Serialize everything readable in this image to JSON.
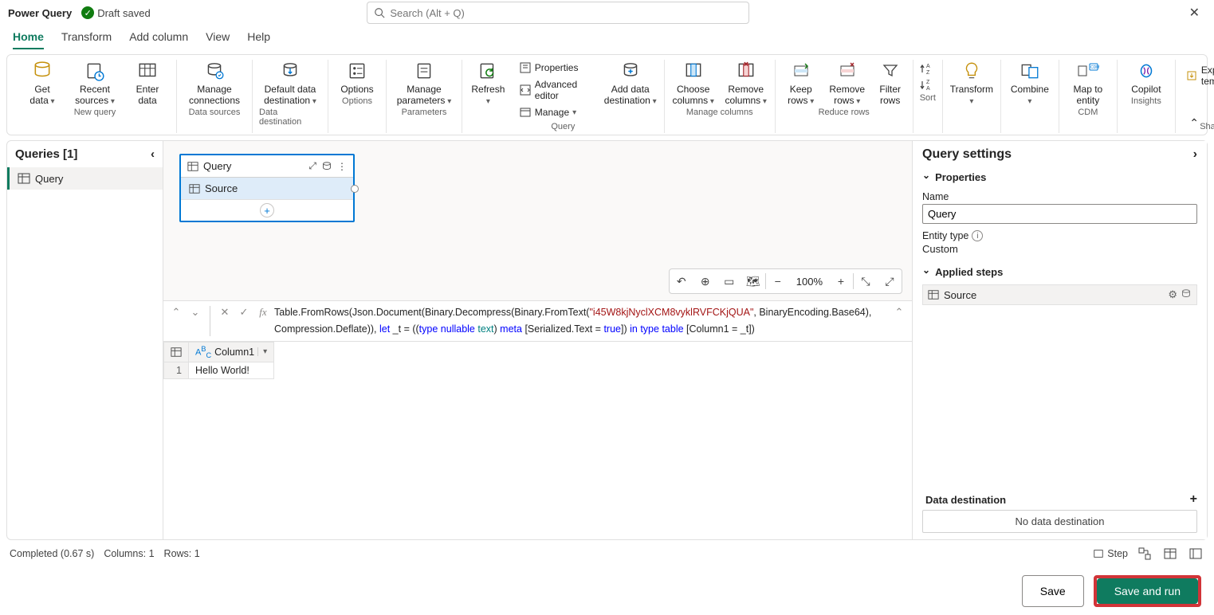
{
  "topbar": {
    "app_title": "Power Query",
    "status": "Draft saved",
    "search_placeholder": "Search (Alt + Q)"
  },
  "tabs": [
    "Home",
    "Transform",
    "Add column",
    "View",
    "Help"
  ],
  "active_tab": "Home",
  "ribbon": {
    "groups": {
      "new_query": {
        "label": "New query",
        "get_data": "Get\ndata",
        "recent_sources": "Recent\nsources",
        "enter_data": "Enter\ndata"
      },
      "data_sources": {
        "label": "Data sources",
        "manage_connections": "Manage\nconnections"
      },
      "data_destination": {
        "label": "Data destination",
        "default_dd": "Default data\ndestination"
      },
      "options": {
        "label": "Options",
        "options": "Options"
      },
      "parameters": {
        "label": "Parameters",
        "manage_params": "Manage\nparameters"
      },
      "query": {
        "label": "Query",
        "refresh": "Refresh",
        "properties": "Properties",
        "advanced_editor": "Advanced editor",
        "manage": "Manage",
        "add_dd": "Add data\ndestination"
      },
      "manage_columns": {
        "label": "Manage columns",
        "choose_cols": "Choose\ncolumns",
        "remove_cols": "Remove\ncolumns"
      },
      "reduce_rows": {
        "label": "Reduce rows",
        "keep_rows": "Keep\nrows",
        "remove_rows": "Remove\nrows",
        "filter_rows": "Filter\nrows"
      },
      "sort": {
        "label": "Sort"
      },
      "transform": {
        "label": "",
        "transform": "Transform"
      },
      "combine": {
        "label": "",
        "combine": "Combine"
      },
      "cdm": {
        "label": "CDM",
        "map_entity": "Map to\nentity"
      },
      "insights": {
        "label": "Insights",
        "copilot": "Copilot"
      },
      "share": {
        "label": "Share",
        "export_template": "Export template"
      }
    }
  },
  "sidebar": {
    "title": "Queries [1]",
    "items": [
      "Query"
    ]
  },
  "diagram": {
    "node_title": "Query",
    "step": "Source"
  },
  "dtoolbar": {
    "zoom": "100%"
  },
  "formula": {
    "p1": "Table.FromRows(Json.Document(Binary.Decompress(Binary.FromText(",
    "str": "\"i45W8kjNyclXCM8vyklRVFCKjQUA\"",
    "p2": ", BinaryEncoding.Base64), Compression.Deflate)), ",
    "kw_let": "let",
    "p3": " _t = ((",
    "kw_type1": "type",
    "sp": " ",
    "kw_nullable": "nullable",
    "kw_text": "text",
    "p4": ") ",
    "kw_meta": "meta",
    "p5": " [Serialized.Text = ",
    "kw_true": "true",
    "p6": "]) ",
    "kw_in": "in",
    "kw_type2": "type",
    "kw_table": "table",
    "p7": " [Column1 = _t])"
  },
  "grid": {
    "col1": "Column1",
    "rows": [
      {
        "n": "1",
        "c1": "Hello World!"
      }
    ]
  },
  "rightpanel": {
    "title": "Query settings",
    "properties": "Properties",
    "name_label": "Name",
    "name_value": "Query",
    "entity_type_label": "Entity type",
    "entity_type_value": "Custom",
    "applied_steps": "Applied steps",
    "step1": "Source",
    "data_destination": "Data destination",
    "no_dest": "No data destination"
  },
  "statusbar": {
    "completed": "Completed (0.67 s)",
    "columns": "Columns: 1",
    "rows": "Rows: 1",
    "step": "Step"
  },
  "footer": {
    "save": "Save",
    "save_run": "Save and run"
  }
}
